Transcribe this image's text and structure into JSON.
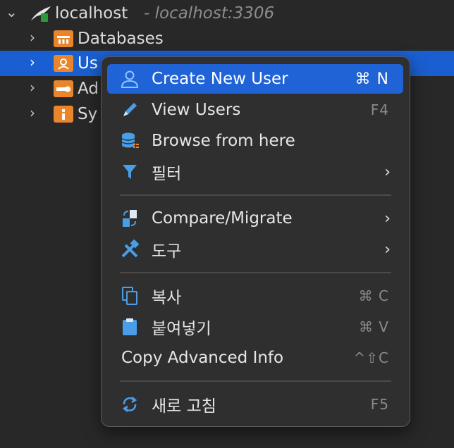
{
  "tree": {
    "root": {
      "label": "localhost",
      "detail": "- localhost:3306",
      "expand_icon": "chevron-down-icon"
    },
    "items": [
      {
        "label": "Databases",
        "icon": "databases-folder-icon"
      },
      {
        "label": "Us",
        "icon": "users-folder-icon"
      },
      {
        "label": "Ad",
        "icon": "admin-folder-icon"
      },
      {
        "label": "Sy",
        "icon": "system-info-folder-icon"
      }
    ]
  },
  "menu": {
    "items": [
      {
        "label": "Create New User",
        "shortcut": "⌘ N",
        "icon": "user-icon",
        "highlighted": true
      },
      {
        "label": "View Users",
        "shortcut": "F4",
        "icon": "pencil-icon"
      },
      {
        "label": "Browse from here",
        "icon": "database-browse-icon"
      },
      {
        "label": "필터",
        "icon": "filter-icon",
        "submenu": true
      },
      {
        "label": "Compare/Migrate",
        "icon": "compare-icon",
        "submenu": true
      },
      {
        "label": "도구",
        "icon": "tools-icon",
        "submenu": true
      },
      {
        "label": "복사",
        "shortcut": "⌘ C",
        "icon": "copy-icon"
      },
      {
        "label": "붙여넣기",
        "shortcut": "⌘ V",
        "icon": "paste-icon"
      },
      {
        "label": "Copy Advanced Info",
        "shortcut": "^⇧C"
      },
      {
        "label": "새로 고침",
        "shortcut": "F5",
        "icon": "refresh-icon"
      }
    ],
    "submenu_arrow": "›"
  },
  "colors": {
    "selection": "#1a5fd1",
    "highlight": "#1f63d6",
    "folder": "#e9852a",
    "icon_blue": "#4a9ee8"
  }
}
